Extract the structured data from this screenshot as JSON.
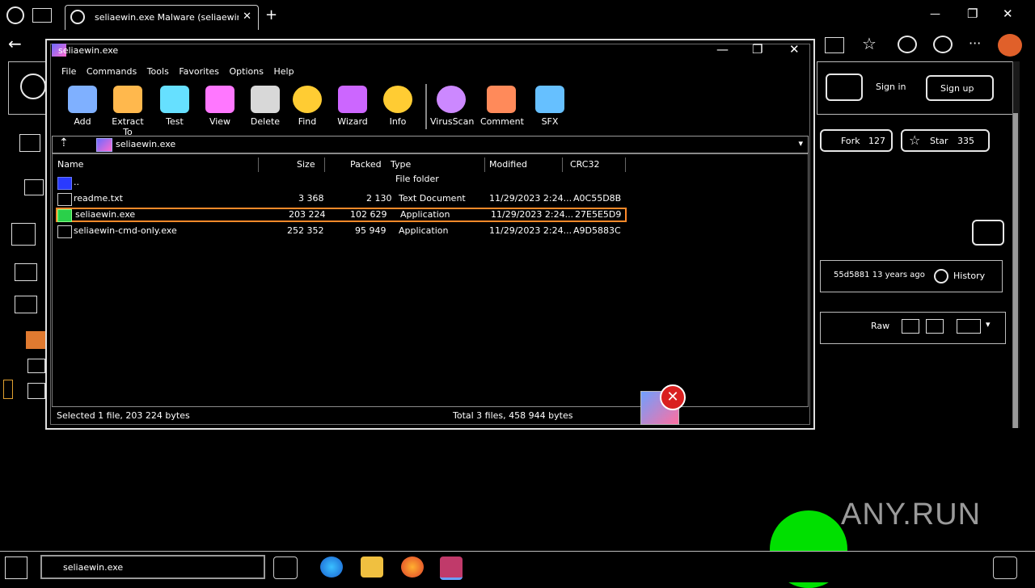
{
  "browser": {
    "tab_title": "seliaewin.exe Malware (seliaewin",
    "tab_close": "✕",
    "new_tab": "+",
    "window_minimize": "—",
    "window_restore": "❐",
    "window_close": "✕"
  },
  "page": {
    "sign_in": "Sign in",
    "sign_up": "Sign up",
    "fork": "Fork",
    "fork_count": "127",
    "star": "Star",
    "star_count": "335",
    "history_text": "55d5881 13 years ago",
    "history_label": "History",
    "raw": "Raw"
  },
  "winrar": {
    "title": "seliaewin.exe",
    "menu": [
      "File",
      "Commands",
      "Tools",
      "Favorites",
      "Options",
      "Help"
    ],
    "toolbar": [
      {
        "label": "Add",
        "icon": "add-icon",
        "color": "#7fb0ff"
      },
      {
        "label": "Extract To",
        "icon": "extract-icon",
        "color": "#ffb84d"
      },
      {
        "label": "Test",
        "icon": "test-icon",
        "color": "#66e0ff"
      },
      {
        "label": "View",
        "icon": "view-icon",
        "color": "#ff77ff"
      },
      {
        "label": "Delete",
        "icon": "delete-icon",
        "color": "#d8d8d8"
      },
      {
        "label": "Find",
        "icon": "find-icon",
        "color": "#ffcc33"
      },
      {
        "label": "Wizard",
        "icon": "wizard-icon",
        "color": "#cc66ff"
      },
      {
        "label": "Info",
        "icon": "info-icon",
        "color": "#ffcc33"
      },
      {
        "label": "VirusScan",
        "icon": "virusscan-icon",
        "color": "#cc88ff"
      },
      {
        "label": "Comment",
        "icon": "comment-icon",
        "color": "#ff8a5a"
      },
      {
        "label": "SFX",
        "icon": "sfx-icon",
        "color": "#66c0ff"
      }
    ],
    "path": "seliaewin.exe",
    "columns": [
      "Name",
      "Size",
      "Packed",
      "Type",
      "Modified",
      "CRC32"
    ],
    "rows": [
      {
        "name": "..",
        "size": "",
        "packed": "",
        "type": "File folder",
        "modified": "",
        "crc": ""
      },
      {
        "name": "readme.txt",
        "size": "3 368",
        "packed": "2 130",
        "type": "Text Document",
        "modified": "11/29/2023 2:24...",
        "crc": "A0C55D8B"
      },
      {
        "name": "seliaewin.exe",
        "size": "203 224",
        "packed": "102 629",
        "type": "Application",
        "modified": "11/29/2023 2:24...",
        "crc": "27E5E5D9"
      },
      {
        "name": "seliaewin-cmd-only.exe",
        "size": "252 352",
        "packed": "95 949",
        "type": "Application",
        "modified": "11/29/2023 2:24...",
        "crc": "A9D5883C"
      }
    ],
    "status_left": "Selected 1 file, 203 224 bytes",
    "status_right": "Total 3 files, 458 944 bytes"
  },
  "taskbar": {
    "winrar_label": "seliaewin.exe"
  },
  "watermark": "ANY.RUN"
}
